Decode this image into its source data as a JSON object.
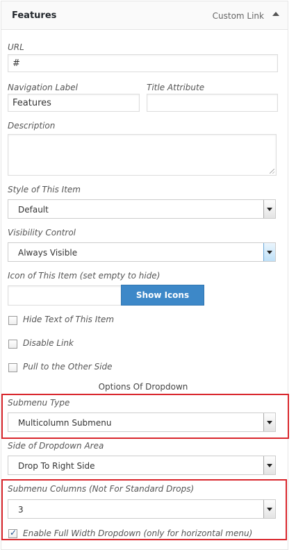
{
  "header": {
    "title": "Features",
    "item_type": "Custom Link"
  },
  "url": {
    "label": "URL",
    "value": "#"
  },
  "nav_label": {
    "label": "Navigation Label",
    "value": "Features"
  },
  "title_attr": {
    "label": "Title Attribute",
    "value": ""
  },
  "description": {
    "label": "Description",
    "value": ""
  },
  "style": {
    "label": "Style of This Item",
    "value": "Default"
  },
  "visibility": {
    "label": "Visibility Control",
    "value": "Always Visible"
  },
  "icon": {
    "label": "Icon of This Item (set empty to hide)",
    "value": "",
    "button": "Show Icons"
  },
  "checkboxes": [
    {
      "label": "Hide Text of This Item",
      "checked": false
    },
    {
      "label": "Disable Link",
      "checked": false
    },
    {
      "label": "Pull to the Other Side",
      "checked": false
    }
  ],
  "dropdown_section": "Options Of Dropdown",
  "submenu_type": {
    "label": "Submenu Type",
    "value": "Multicolumn Submenu"
  },
  "dropdown_side": {
    "label": "Side of Dropdown Area",
    "value": "Drop To Right Side"
  },
  "submenu_columns": {
    "label": "Submenu Columns (Not For Standard Drops)",
    "value": "3"
  },
  "full_width": {
    "label": "Enable Full Width Dropdown (only for horizontal menu)",
    "checked": true
  },
  "highlight_color": "#d9262c",
  "button_color": "#3d88c8"
}
